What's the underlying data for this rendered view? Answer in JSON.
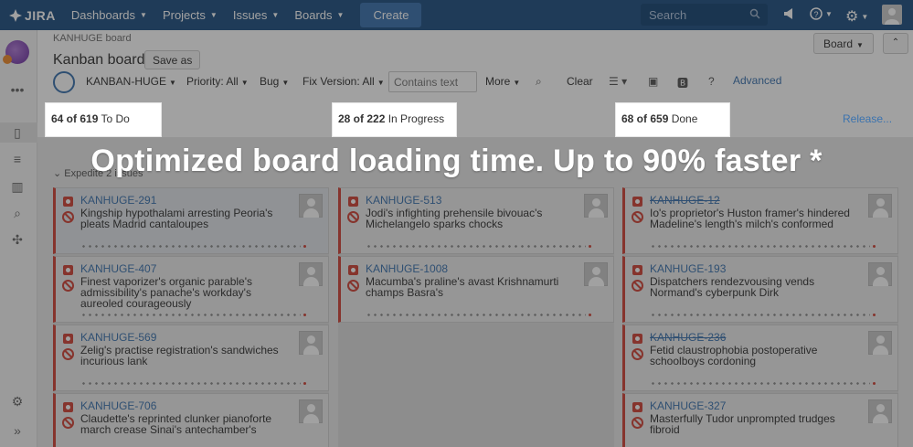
{
  "topnav": {
    "brand": "JIRA",
    "menus": [
      {
        "label": "Dashboards"
      },
      {
        "label": "Projects"
      },
      {
        "label": "Issues"
      },
      {
        "label": "Boards"
      }
    ],
    "create_label": "Create",
    "search_placeholder": "Search"
  },
  "header": {
    "breadcrumb": "KANHUGE board",
    "title": "Kanban board",
    "save_as_label": "Save as",
    "board_button_label": "Board"
  },
  "filters": {
    "project": "KANBAN-HUGE",
    "priority": "Priority: All",
    "type": "Bug",
    "fix_version": "Fix Version: All",
    "text_placeholder": "Contains text",
    "more": "More",
    "clear": "Clear",
    "advanced": "Advanced"
  },
  "columns": [
    {
      "count": "64 of 619",
      "name": "To Do"
    },
    {
      "count": "28 of 222",
      "name": "In Progress"
    },
    {
      "count": "68 of 659",
      "name": "Done"
    }
  ],
  "release_link": "Release...",
  "swimlane_label": "Expedite 2 issues",
  "headline": "Optimized board loading time. Up to 90% faster *",
  "cards": {
    "todo": [
      {
        "key": "KANHUGE-291",
        "summary": "Kingship hypothalami arresting Peoria's pleats Madrid cantaloupes"
      },
      {
        "key": "KANHUGE-407",
        "summary": "Finest vaporizer's organic parable's admissibility's panache's workday's aureoled courageously"
      },
      {
        "key": "KANHUGE-569",
        "summary": "Zelig's practise registration's sandwiches incurious lank"
      },
      {
        "key": "KANHUGE-706",
        "summary": "Claudette's reprinted clunker pianoforte march crease Sinai's antechamber's"
      }
    ],
    "inprogress": [
      {
        "key": "KANHUGE-513",
        "summary": "Jodi's infighting prehensile bivouac's Michelangelo sparks chocks"
      },
      {
        "key": "KANHUGE-1008",
        "summary": "Macumba's praline's avast Krishnamurti champs Basra's"
      }
    ],
    "done": [
      {
        "key": "KANHUGE-12",
        "summary": "Io's proprietor's Huston framer's hindered Madeline's length's milch's conformed"
      },
      {
        "key": "KANHUGE-193",
        "summary": "Dispatchers rendezvousing vends Normand's cyberpunk Dirk"
      },
      {
        "key": "KANHUGE-236",
        "summary": "Fetid claustrophobia postoperative schoolboys cordoning"
      },
      {
        "key": "KANHUGE-327",
        "summary": "Masterfully Tudor unprompted trudges fibroid"
      }
    ]
  },
  "icons": {
    "brand_accent": "#205081",
    "link_color": "#3b73af",
    "bug_color": "#d04437"
  }
}
